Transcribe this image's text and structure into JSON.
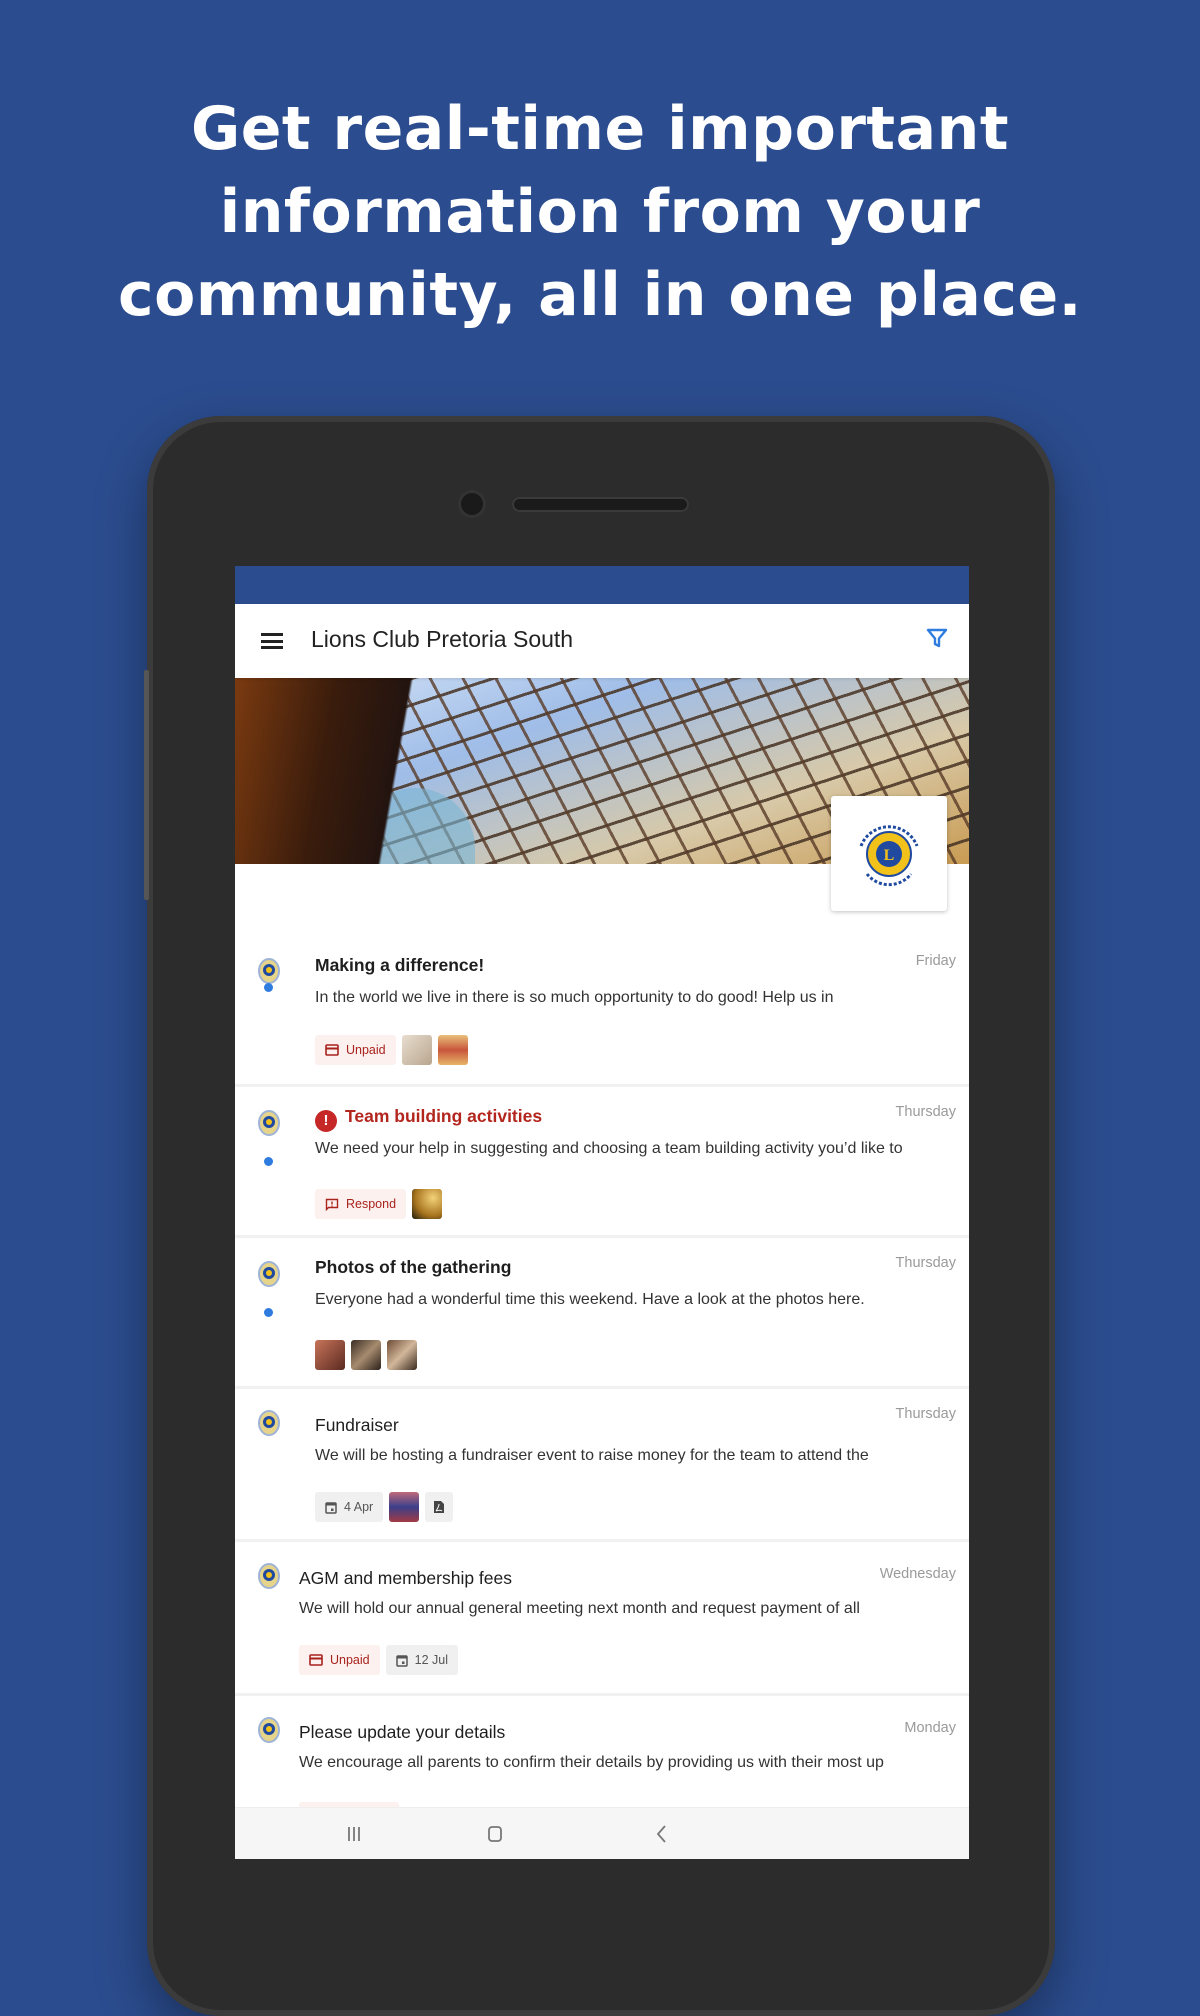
{
  "headline": [
    "Get real-time important",
    "information from your",
    "community, all in one place."
  ],
  "app": {
    "title": "Lions Club Pretoria South",
    "accent": "#2b4c8e",
    "link_blue": "#2f7ce0",
    "alert_red": "#c62828"
  },
  "logo": {
    "text_top": "PRETORIA SOUTH",
    "text_band": "LIONS",
    "letter": "L",
    "text_bottom": "LIONS CLUB"
  },
  "items": [
    {
      "title": "Making a difference!",
      "date": "Friday",
      "body": "In the world we live in there is so much opportunity to do good! Help us in",
      "unread": true,
      "style": "bold",
      "chips": [
        {
          "type": "card",
          "label": "Unpaid"
        }
      ]
    },
    {
      "title": "Team building activities",
      "date": "Thursday",
      "body": "We need your help in suggesting and choosing a team building activity you’d like to",
      "unread": true,
      "style": "alert",
      "chips": [
        {
          "type": "feedback",
          "label": "Respond"
        }
      ]
    },
    {
      "title": "Photos of the gathering",
      "date": "Thursday",
      "body": "Everyone had a wonderful time this weekend. Have a look at the photos here.",
      "unread": true,
      "style": "bold",
      "chips": []
    },
    {
      "title": "Fundraiser",
      "date": "Thursday",
      "body": "We will be hosting a fundraiser event to raise money for the team to attend the",
      "unread": false,
      "style": "normal",
      "chips": [
        {
          "type": "calendar",
          "label": "4 Apr"
        }
      ]
    },
    {
      "title": "AGM and membership fees",
      "date": "Wednesday",
      "body": "We will hold our annual general meeting next month and request payment of all",
      "unread": false,
      "style": "normal",
      "chips": [
        {
          "type": "card",
          "label": "Unpaid"
        },
        {
          "type": "calendar",
          "label": "12 Jul"
        }
      ]
    },
    {
      "title": "Please update your details",
      "date": "Monday",
      "body": "We encourage all parents to confirm their details by providing us with their most up",
      "unread": false,
      "style": "normal",
      "chips": []
    }
  ],
  "navbar": [
    "recent-apps",
    "home",
    "back"
  ]
}
